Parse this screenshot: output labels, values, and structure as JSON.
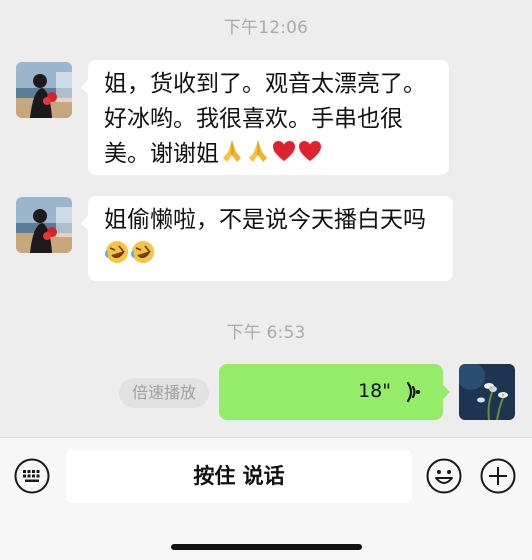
{
  "chat": {
    "timestamps": [
      "下午12:06",
      "下午 6:53"
    ],
    "messages": [
      {
        "sender": "other",
        "text": "姐，货收到了。观音太漂亮了。好冰哟。我很喜欢。手串也很美。谢谢姐",
        "emojis": [
          "folded-hands",
          "folded-hands",
          "red-heart",
          "red-heart"
        ]
      },
      {
        "sender": "other",
        "text": "姐偷懒啦，不是说今天播白天吗",
        "emojis": [
          "rofl",
          "rofl"
        ]
      },
      {
        "sender": "self",
        "type": "voice",
        "duration": "18\""
      }
    ],
    "speed_button": "倍速播放"
  },
  "input_bar": {
    "hold_to_talk": "按住 说话"
  },
  "colors": {
    "background": "#ededed",
    "self_bubble": "#95ec69",
    "other_bubble": "#ffffff"
  }
}
